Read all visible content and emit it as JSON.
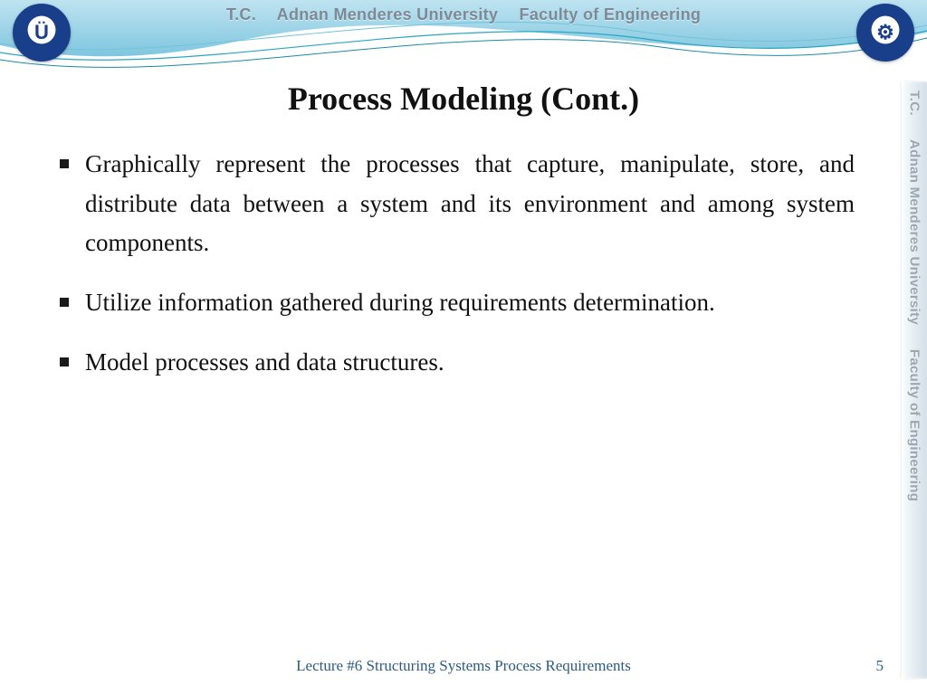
{
  "banner": {
    "tc": "T.C.",
    "university": "Adnan Menderes University",
    "faculty": "Faculty of Engineering"
  },
  "logos": {
    "left_initial": "Ü",
    "right_initial": "⚙"
  },
  "title": "Process Modeling (Cont.)",
  "bullets": [
    "Graphically represent the processes that capture, manipulate, store, and distribute data between a system and its environment and among system components.",
    "Utilize information gathered during requirements determination.",
    "Model processes and data structures."
  ],
  "footer": {
    "lecture": "Lecture #6 Structuring Systems Process Requirements",
    "page": "5"
  }
}
